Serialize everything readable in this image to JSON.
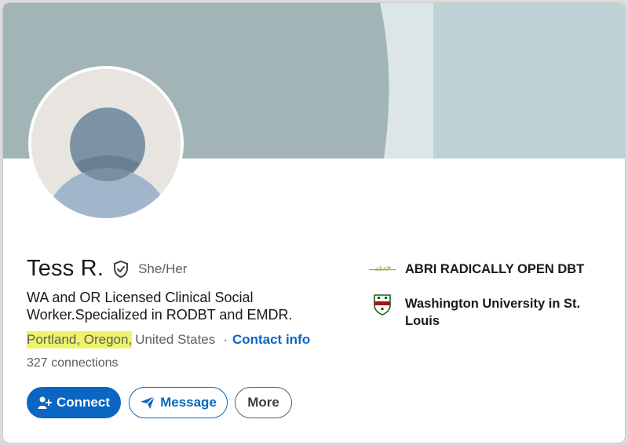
{
  "profile": {
    "name": "Tess R.",
    "pronouns": "She/Her",
    "headline": "WA and OR Licensed Clinical Social Worker.Specialized in RODBT and EMDR.",
    "location_highlighted": "Portland, Oregon,",
    "location_rest": "United States",
    "separator": "·",
    "contact_label": "Contact info",
    "connections": "327 connections"
  },
  "actions": {
    "connect_label": "Connect",
    "message_label": "Message",
    "more_label": "More"
  },
  "organizations": [
    {
      "name": "ABRI RADICALLY OPEN DBT",
      "logo_icon": "abri-logo"
    },
    {
      "name": "Washington University in St. Louis",
      "logo_icon": "washu-shield-logo"
    }
  ],
  "colors": {
    "brand_blue": "#0a66c2",
    "highlight": "#eff36a",
    "banner": "#bfd3d6"
  },
  "icons": {
    "verified": "shield-check-icon",
    "connect": "add-person-icon",
    "message": "send-icon"
  }
}
